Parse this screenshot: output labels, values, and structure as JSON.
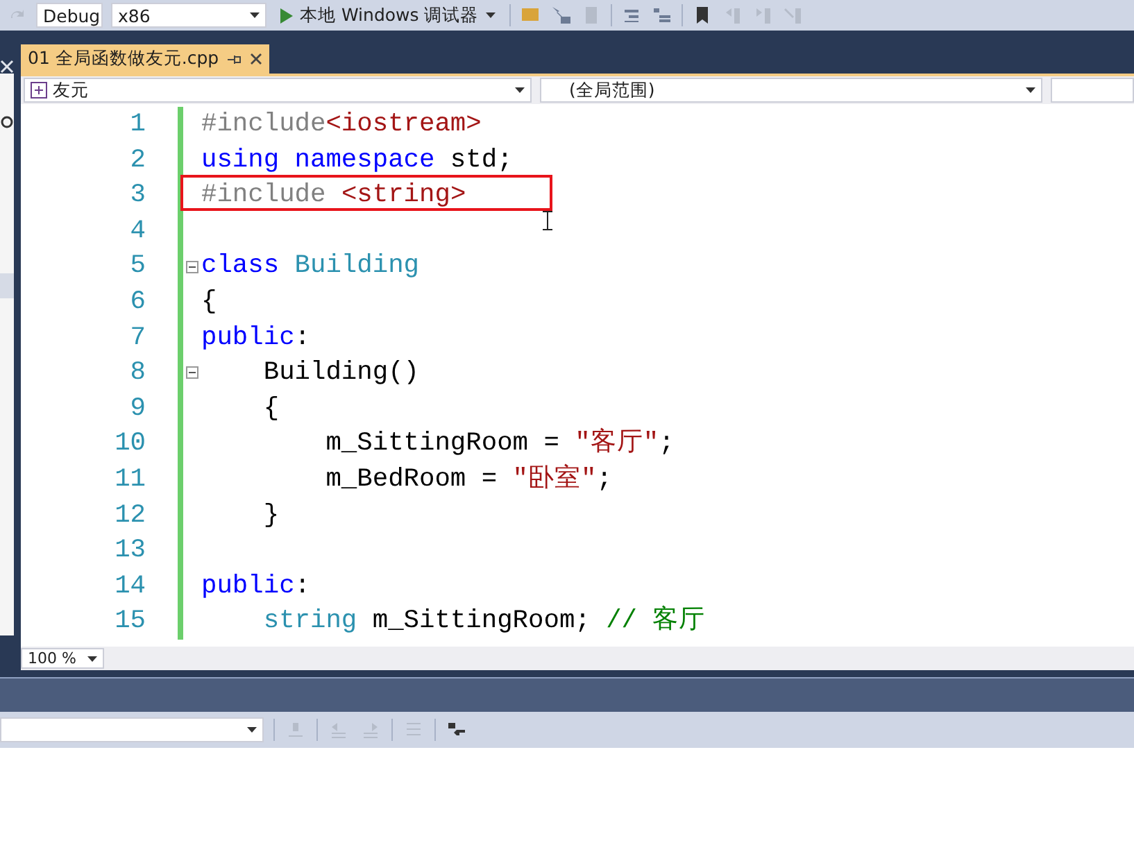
{
  "toolbar": {
    "configuration": "Debug",
    "platform": "x86",
    "run_label": "本地 Windows 调试器"
  },
  "document_tabs": [
    {
      "label": "01 全局函数做友元.cpp",
      "selected": true
    }
  ],
  "navigation_bar": {
    "scope": "友元",
    "member": "(全局范围)"
  },
  "code_lines": [
    {
      "number": "1",
      "tokens": [
        {
          "kind": "preprocessor",
          "text": "#include"
        },
        {
          "kind": "string",
          "text": "<iostream>"
        }
      ]
    },
    {
      "number": "2",
      "tokens": [
        {
          "kind": "keyword",
          "text": "using namespace"
        },
        {
          "kind": "plain",
          "text": " std;"
        }
      ]
    },
    {
      "number": "3",
      "highlighted": true,
      "tokens": [
        {
          "kind": "preprocessor",
          "text": "#include "
        },
        {
          "kind": "string",
          "text": "<string>"
        }
      ]
    },
    {
      "number": "4"
    },
    {
      "number": "5",
      "fold_expanded": true,
      "tokens": [
        {
          "kind": "keyword",
          "text": "class"
        },
        {
          "kind": "type",
          "text": " Building"
        }
      ]
    },
    {
      "number": "6",
      "tokens": [
        {
          "kind": "plain",
          "text": "{"
        }
      ]
    },
    {
      "number": "7",
      "tokens": [
        {
          "kind": "keyword",
          "text": "public"
        },
        {
          "kind": "plain",
          "text": ":"
        }
      ]
    },
    {
      "number": "8",
      "fold_expanded": true,
      "tokens": [
        {
          "kind": "plain",
          "text": "    Building()"
        }
      ]
    },
    {
      "number": "9",
      "tokens": [
        {
          "kind": "plain",
          "text": "    {"
        }
      ]
    },
    {
      "number": "10",
      "tokens": [
        {
          "kind": "plain",
          "text": "        m_SittingRoom = "
        },
        {
          "kind": "string",
          "text": "\"客厅\""
        },
        {
          "kind": "plain",
          "text": ";"
        }
      ]
    },
    {
      "number": "11",
      "tokens": [
        {
          "kind": "plain",
          "text": "        m_BedRoom = "
        },
        {
          "kind": "string",
          "text": "\"卧室\""
        },
        {
          "kind": "plain",
          "text": ";"
        }
      ]
    },
    {
      "number": "12",
      "tokens": [
        {
          "kind": "plain",
          "text": "    }"
        }
      ]
    },
    {
      "number": "13"
    },
    {
      "number": "14",
      "tokens": [
        {
          "kind": "keyword",
          "text": "public"
        },
        {
          "kind": "plain",
          "text": ":"
        }
      ]
    },
    {
      "number": "15",
      "tokens": [
        {
          "kind": "type",
          "text": "    string"
        },
        {
          "kind": "plain",
          "text": " m_SittingRoom; "
        },
        {
          "kind": "comment",
          "text": "// 客厅"
        }
      ]
    }
  ],
  "zoom": "100 %"
}
